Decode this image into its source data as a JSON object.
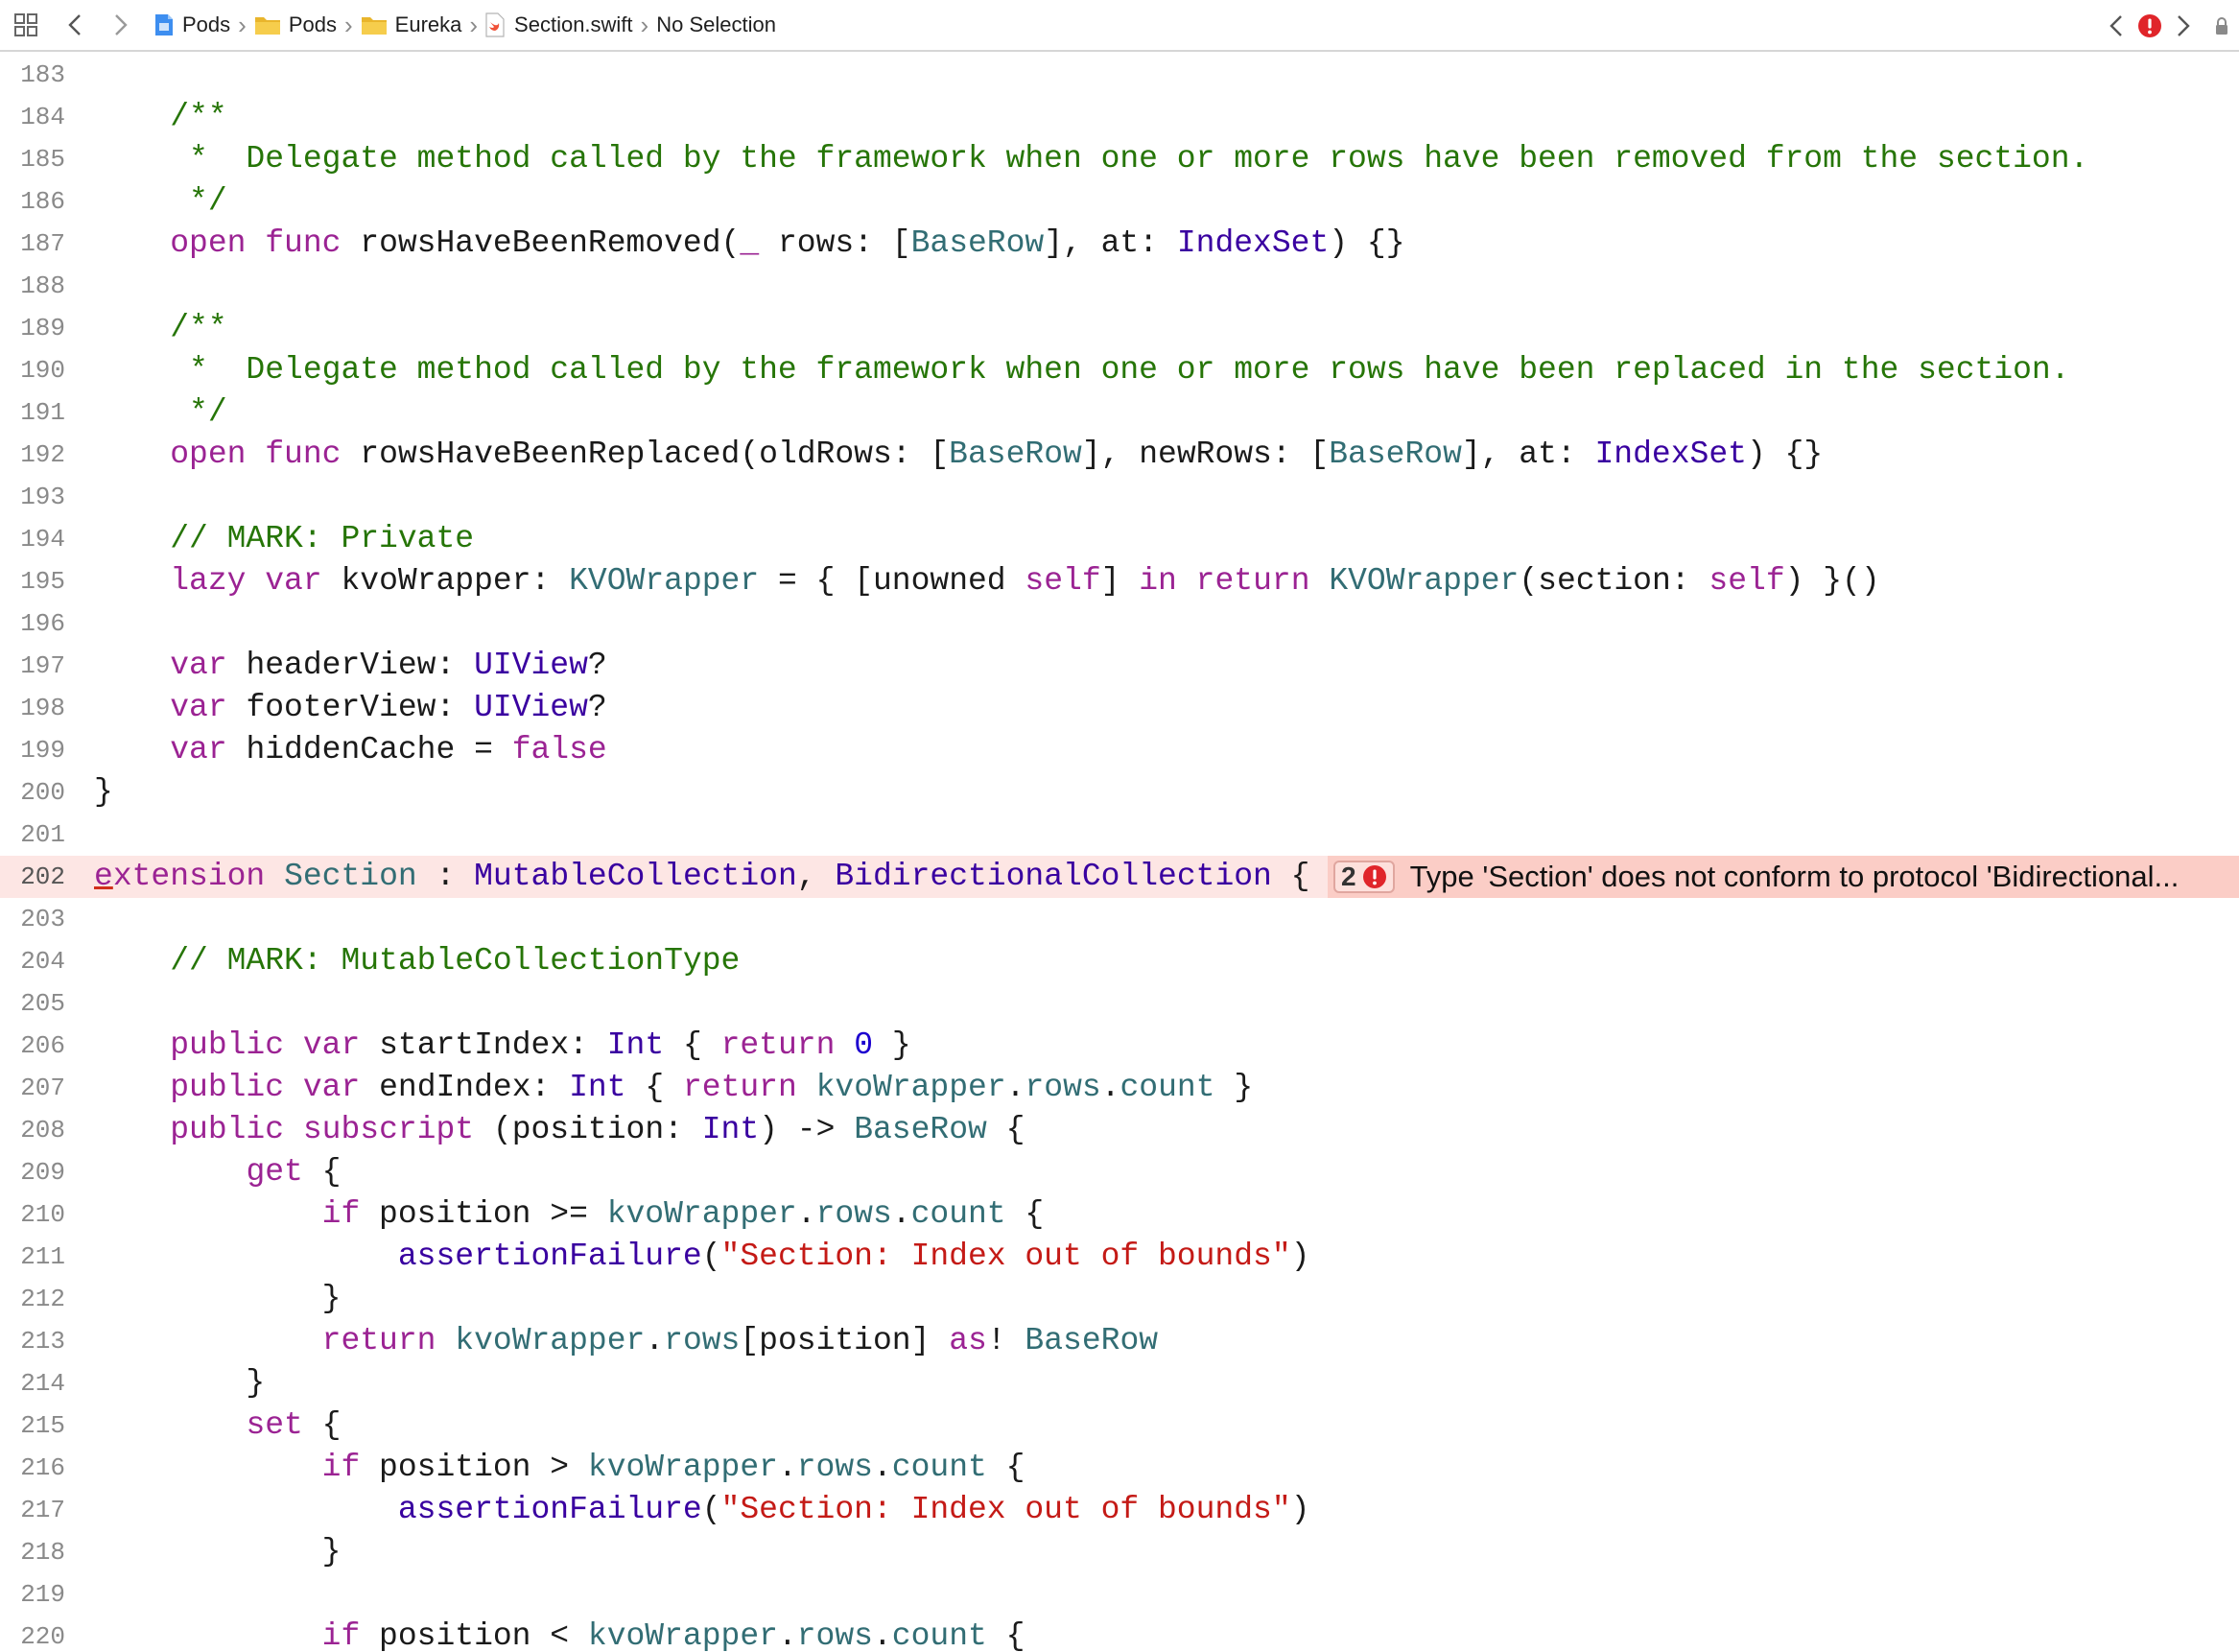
{
  "jumpbar": {
    "breadcrumbs": [
      {
        "label": "Pods",
        "icon": "project-icon"
      },
      {
        "label": "Pods",
        "icon": "folder-icon"
      },
      {
        "label": "Eureka",
        "icon": "folder-icon"
      },
      {
        "label": "Section.swift",
        "icon": "swift-file-icon"
      },
      {
        "label": "No Selection",
        "icon": ""
      }
    ],
    "error_indicator": "error-icon",
    "colors": {
      "error": "#e0252a",
      "folder": "#f5c842",
      "swift": "#f05138"
    }
  },
  "error_annotation": {
    "count": "2",
    "message": "Type 'Section' does not conform to protocol 'Bidirectional..."
  },
  "editor": {
    "lines": [
      {
        "no": "183",
        "tokens": []
      },
      {
        "no": "184",
        "tokens": [
          [
            "pl",
            "    "
          ],
          [
            "cm",
            "/**"
          ]
        ]
      },
      {
        "no": "185",
        "tokens": [
          [
            "pl",
            "    "
          ],
          [
            "cm",
            " *  Delegate method called by the framework when one or more rows have been removed from the section."
          ]
        ]
      },
      {
        "no": "186",
        "tokens": [
          [
            "pl",
            "    "
          ],
          [
            "cm",
            " */"
          ]
        ]
      },
      {
        "no": "187",
        "tokens": [
          [
            "pl",
            "    "
          ],
          [
            "kw",
            "open"
          ],
          [
            "pl",
            " "
          ],
          [
            "kw",
            "func"
          ],
          [
            "pl",
            " rowsHaveBeenRemoved("
          ],
          [
            "kw",
            "_"
          ],
          [
            "pl",
            " rows: ["
          ],
          [
            "pt",
            "BaseRow"
          ],
          [
            "pl",
            "], at: "
          ],
          [
            "ty",
            "IndexSet"
          ],
          [
            "pl",
            ") {}"
          ]
        ]
      },
      {
        "no": "188",
        "tokens": []
      },
      {
        "no": "189",
        "tokens": [
          [
            "pl",
            "    "
          ],
          [
            "cm",
            "/**"
          ]
        ]
      },
      {
        "no": "190",
        "tokens": [
          [
            "pl",
            "    "
          ],
          [
            "cm",
            " *  Delegate method called by the framework when one or more rows have been replaced in the section."
          ]
        ]
      },
      {
        "no": "191",
        "tokens": [
          [
            "pl",
            "    "
          ],
          [
            "cm",
            " */"
          ]
        ]
      },
      {
        "no": "192",
        "tokens": [
          [
            "pl",
            "    "
          ],
          [
            "kw",
            "open"
          ],
          [
            "pl",
            " "
          ],
          [
            "kw",
            "func"
          ],
          [
            "pl",
            " rowsHaveBeenReplaced(oldRows: ["
          ],
          [
            "pt",
            "BaseRow"
          ],
          [
            "pl",
            "], newRows: ["
          ],
          [
            "pt",
            "BaseRow"
          ],
          [
            "pl",
            "], at: "
          ],
          [
            "ty",
            "IndexSet"
          ],
          [
            "pl",
            ") {}"
          ]
        ]
      },
      {
        "no": "193",
        "tokens": []
      },
      {
        "no": "194",
        "tokens": [
          [
            "pl",
            "    "
          ],
          [
            "cm",
            "// MARK: Private"
          ]
        ]
      },
      {
        "no": "195",
        "tokens": [
          [
            "pl",
            "    "
          ],
          [
            "kw",
            "lazy"
          ],
          [
            "pl",
            " "
          ],
          [
            "kw",
            "var"
          ],
          [
            "pl",
            " kvoWrapper: "
          ],
          [
            "pt",
            "KVOWrapper"
          ],
          [
            "pl",
            " = { [unowned "
          ],
          [
            "kw",
            "self"
          ],
          [
            "pl",
            "] "
          ],
          [
            "kw",
            "in"
          ],
          [
            "pl",
            " "
          ],
          [
            "kw",
            "return"
          ],
          [
            "pl",
            " "
          ],
          [
            "pt",
            "KVOWrapper"
          ],
          [
            "pl",
            "(section: "
          ],
          [
            "kw",
            "self"
          ],
          [
            "pl",
            ") }()"
          ]
        ]
      },
      {
        "no": "196",
        "tokens": []
      },
      {
        "no": "197",
        "tokens": [
          [
            "pl",
            "    "
          ],
          [
            "kw",
            "var"
          ],
          [
            "pl",
            " headerView: "
          ],
          [
            "ty",
            "UIView"
          ],
          [
            "pl",
            "?"
          ]
        ]
      },
      {
        "no": "198",
        "tokens": [
          [
            "pl",
            "    "
          ],
          [
            "kw",
            "var"
          ],
          [
            "pl",
            " footerView: "
          ],
          [
            "ty",
            "UIView"
          ],
          [
            "pl",
            "?"
          ]
        ]
      },
      {
        "no": "199",
        "tokens": [
          [
            "pl",
            "    "
          ],
          [
            "kw",
            "var"
          ],
          [
            "pl",
            " hiddenCache = "
          ],
          [
            "kw",
            "false"
          ]
        ]
      },
      {
        "no": "200",
        "tokens": [
          [
            "pl",
            "}"
          ]
        ]
      },
      {
        "no": "201",
        "tokens": []
      },
      {
        "no": "202",
        "error": true,
        "tokens": [
          [
            "kw ul",
            "e"
          ],
          [
            "kw",
            "xtension"
          ],
          [
            "pl",
            " "
          ],
          [
            "pt",
            "Section"
          ],
          [
            "pl",
            " : "
          ],
          [
            "ty",
            "MutableCollection"
          ],
          [
            "pl",
            ", "
          ],
          [
            "ty",
            "BidirectionalCollection"
          ],
          [
            "pl",
            " {"
          ]
        ]
      },
      {
        "no": "203",
        "tokens": []
      },
      {
        "no": "204",
        "tokens": [
          [
            "pl",
            "    "
          ],
          [
            "cm",
            "// MARK: MutableCollectionType"
          ]
        ]
      },
      {
        "no": "205",
        "tokens": []
      },
      {
        "no": "206",
        "tokens": [
          [
            "pl",
            "    "
          ],
          [
            "kw",
            "public"
          ],
          [
            "pl",
            " "
          ],
          [
            "kw",
            "var"
          ],
          [
            "pl",
            " startIndex: "
          ],
          [
            "ty",
            "Int"
          ],
          [
            "pl",
            " { "
          ],
          [
            "kw",
            "return"
          ],
          [
            "pl",
            " "
          ],
          [
            "nm",
            "0"
          ],
          [
            "pl",
            " }"
          ]
        ]
      },
      {
        "no": "207",
        "tokens": [
          [
            "pl",
            "    "
          ],
          [
            "kw",
            "public"
          ],
          [
            "pl",
            " "
          ],
          [
            "kw",
            "var"
          ],
          [
            "pl",
            " endIndex: "
          ],
          [
            "ty",
            "Int"
          ],
          [
            "pl",
            " { "
          ],
          [
            "kw",
            "return"
          ],
          [
            "pl",
            " "
          ],
          [
            "pt",
            "kvoWrapper"
          ],
          [
            "pl",
            "."
          ],
          [
            "pt",
            "rows"
          ],
          [
            "pl",
            "."
          ],
          [
            "pt",
            "count"
          ],
          [
            "pl",
            " }"
          ]
        ]
      },
      {
        "no": "208",
        "tokens": [
          [
            "pl",
            "    "
          ],
          [
            "kw",
            "public"
          ],
          [
            "pl",
            " "
          ],
          [
            "kw",
            "subscript"
          ],
          [
            "pl",
            " (position: "
          ],
          [
            "ty",
            "Int"
          ],
          [
            "pl",
            ") -> "
          ],
          [
            "pt",
            "BaseRow"
          ],
          [
            "pl",
            " {"
          ]
        ]
      },
      {
        "no": "209",
        "tokens": [
          [
            "pl",
            "        "
          ],
          [
            "kw",
            "get"
          ],
          [
            "pl",
            " {"
          ]
        ]
      },
      {
        "no": "210",
        "tokens": [
          [
            "pl",
            "            "
          ],
          [
            "kw",
            "if"
          ],
          [
            "pl",
            " position >= "
          ],
          [
            "pt",
            "kvoWrapper"
          ],
          [
            "pl",
            "."
          ],
          [
            "pt",
            "rows"
          ],
          [
            "pl",
            "."
          ],
          [
            "pt",
            "count"
          ],
          [
            "pl",
            " {"
          ]
        ]
      },
      {
        "no": "211",
        "tokens": [
          [
            "pl",
            "                "
          ],
          [
            "ty",
            "assertionFailure"
          ],
          [
            "pl",
            "("
          ],
          [
            "st",
            "\"Section: Index out of bounds\""
          ],
          [
            "pl",
            ")"
          ]
        ]
      },
      {
        "no": "212",
        "tokens": [
          [
            "pl",
            "            }"
          ]
        ]
      },
      {
        "no": "213",
        "tokens": [
          [
            "pl",
            "            "
          ],
          [
            "kw",
            "return"
          ],
          [
            "pl",
            " "
          ],
          [
            "pt",
            "kvoWrapper"
          ],
          [
            "pl",
            "."
          ],
          [
            "pt",
            "rows"
          ],
          [
            "pl",
            "[position] "
          ],
          [
            "kw",
            "as"
          ],
          [
            "pl",
            "! "
          ],
          [
            "pt",
            "BaseRow"
          ]
        ]
      },
      {
        "no": "214",
        "tokens": [
          [
            "pl",
            "        }"
          ]
        ]
      },
      {
        "no": "215",
        "tokens": [
          [
            "pl",
            "        "
          ],
          [
            "kw",
            "set"
          ],
          [
            "pl",
            " {"
          ]
        ]
      },
      {
        "no": "216",
        "tokens": [
          [
            "pl",
            "            "
          ],
          [
            "kw",
            "if"
          ],
          [
            "pl",
            " position > "
          ],
          [
            "pt",
            "kvoWrapper"
          ],
          [
            "pl",
            "."
          ],
          [
            "pt",
            "rows"
          ],
          [
            "pl",
            "."
          ],
          [
            "pt",
            "count"
          ],
          [
            "pl",
            " {"
          ]
        ]
      },
      {
        "no": "217",
        "tokens": [
          [
            "pl",
            "                "
          ],
          [
            "ty",
            "assertionFailure"
          ],
          [
            "pl",
            "("
          ],
          [
            "st",
            "\"Section: Index out of bounds\""
          ],
          [
            "pl",
            ")"
          ]
        ]
      },
      {
        "no": "218",
        "tokens": [
          [
            "pl",
            "            }"
          ]
        ]
      },
      {
        "no": "219",
        "tokens": []
      },
      {
        "no": "220",
        "tokens": [
          [
            "pl",
            "            "
          ],
          [
            "kw",
            "if"
          ],
          [
            "pl",
            " position < "
          ],
          [
            "pt",
            "kvoWrapper"
          ],
          [
            "pl",
            "."
          ],
          [
            "pt",
            "rows"
          ],
          [
            "pl",
            "."
          ],
          [
            "pt",
            "count"
          ],
          [
            "pl",
            " {"
          ]
        ]
      }
    ]
  }
}
